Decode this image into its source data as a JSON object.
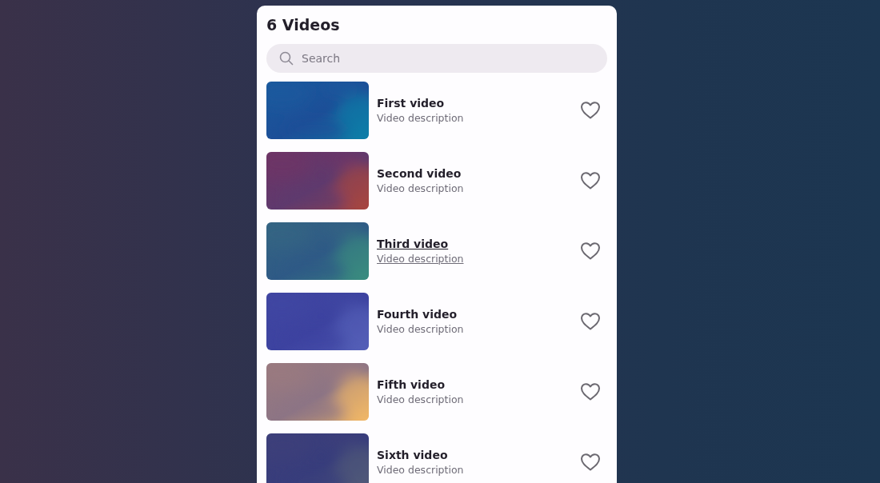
{
  "title": "6 Videos",
  "search": {
    "placeholder": "Search"
  },
  "videos": [
    {
      "title": "First video",
      "description": "Video description",
      "hovered": false,
      "liked": false
    },
    {
      "title": "Second video",
      "description": "Video description",
      "hovered": false,
      "liked": false
    },
    {
      "title": "Third video",
      "description": "Video description",
      "hovered": true,
      "liked": false
    },
    {
      "title": "Fourth video",
      "description": "Video description",
      "hovered": false,
      "liked": false
    },
    {
      "title": "Fifth video",
      "description": "Video description",
      "hovered": false,
      "liked": false
    },
    {
      "title": "Sixth video",
      "description": "Video description",
      "hovered": false,
      "liked": false
    }
  ]
}
